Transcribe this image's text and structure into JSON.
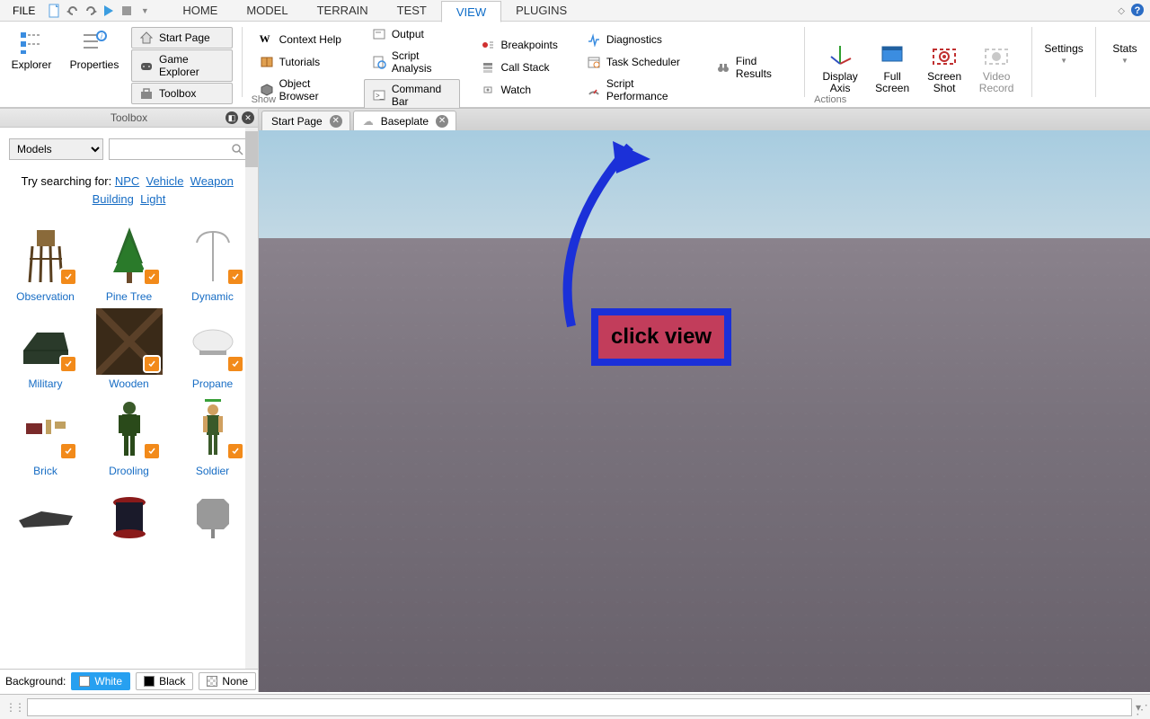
{
  "menu": {
    "file": "FILE",
    "tabs": [
      "HOME",
      "MODEL",
      "TERRAIN",
      "TEST",
      "VIEW",
      "PLUGINS"
    ],
    "active_tab": "VIEW"
  },
  "ribbon": {
    "explorer": "Explorer",
    "properties": "Properties",
    "start_page": "Start Page",
    "game_explorer": "Game Explorer",
    "toolbox": "Toolbox",
    "context_help": "Context Help",
    "tutorials": "Tutorials",
    "object_browser": "Object Browser",
    "output": "Output",
    "script_analysis": "Script Analysis",
    "command_bar": "Command Bar",
    "breakpoints": "Breakpoints",
    "call_stack": "Call Stack",
    "watch": "Watch",
    "diagnostics": "Diagnostics",
    "task_scheduler": "Task Scheduler",
    "script_performance": "Script Performance",
    "find_results": "Find Results",
    "show_label": "Show",
    "display_axis": "Display Axis",
    "full_screen": "Full Screen",
    "screen_shot": "Screen Shot",
    "video_record": "Video Record",
    "actions_label": "Actions",
    "settings": "Settings",
    "stats": "Stats"
  },
  "toolbox": {
    "title": "Toolbox",
    "dropdown_selected": "Models",
    "try_text": "Try searching for:",
    "try_links": [
      "NPC",
      "Vehicle",
      "Weapon",
      "Building",
      "Light"
    ],
    "items": [
      {
        "name": "Observation"
      },
      {
        "name": "Pine Tree"
      },
      {
        "name": "Dynamic"
      },
      {
        "name": "Military"
      },
      {
        "name": "Wooden"
      },
      {
        "name": "Propane"
      },
      {
        "name": "Brick"
      },
      {
        "name": "Drooling"
      },
      {
        "name": "Soldier"
      }
    ],
    "background_label": "Background:",
    "bg_options": [
      "White",
      "Black",
      "None"
    ]
  },
  "viewport_tabs": [
    "Start Page",
    "Baseplate"
  ],
  "callout": "click view"
}
